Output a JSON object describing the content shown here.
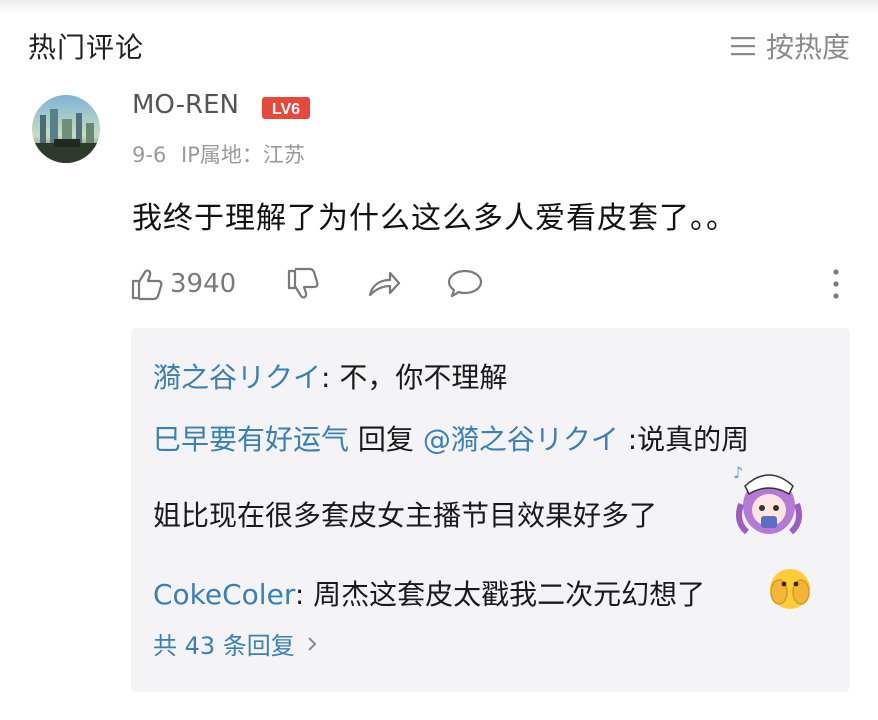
{
  "header": {
    "title": "热门评论",
    "sort_label": "按热度",
    "sort_icon": "list-icon"
  },
  "comment": {
    "username": "MO-REN",
    "level_badge": "LV6",
    "date": "9-6",
    "ip_location": "IP属地：江苏",
    "text": "我终于理解了为什么这么多人爱看皮套了。。",
    "like_count": "3940",
    "icons": [
      "thumbs-up-icon",
      "thumbs-down-icon",
      "share-icon",
      "comment-icon",
      "more-icon"
    ]
  },
  "replies": [
    {
      "author": "漪之谷リクイ",
      "separator": ":",
      "text": " 不，你不理解"
    },
    {
      "author": "巳早要有好运气",
      "reply_word": " 回复 ",
      "mention": "@漪之谷リクイ",
      "text_line1": " :说真的周",
      "text_line2": "姐比现在很多套皮女主播节目效果好多了",
      "sticker": "anime-girl-sticker"
    },
    {
      "author": "CokeColer",
      "separator": ":",
      "text": " 周杰这套皮太戳我二次元幻想了",
      "emoji": "face-with-hands-emoji"
    }
  ],
  "more_replies_label": "共 43 条回复",
  "colors": {
    "link": "#3a7fb8",
    "badge": "#e8473c",
    "reply_bg": "#f4f4f6"
  }
}
